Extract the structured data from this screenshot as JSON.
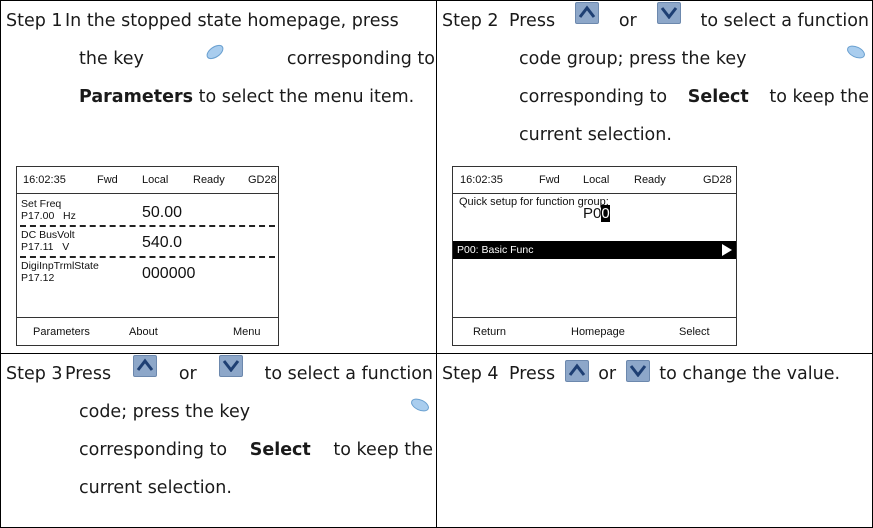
{
  "steps": [
    {
      "number": "Step 1",
      "lines": [
        "In the stopped state homepage, press",
        "the key",
        "corresponding to",
        "Parameters",
        "to select the menu item."
      ]
    },
    {
      "number": "Step 2",
      "lines": [
        "Press",
        "or",
        "to select a function",
        "code group; press the key",
        "corresponding to",
        "Select",
        "to keep the",
        "current selection."
      ]
    },
    {
      "number": "Step 3",
      "lines": [
        "Press",
        "or",
        "to select a function",
        "code; press the key",
        "corresponding to",
        "Select",
        "to keep the",
        "current selection."
      ]
    },
    {
      "number": "Step 4",
      "lines": [
        "Press",
        "or",
        "to change the value."
      ]
    }
  ],
  "screen1": {
    "status": {
      "time": "16:02:35",
      "dir": "Fwd",
      "mode": "Local",
      "state": "Ready",
      "model": "GD28"
    },
    "rows": [
      {
        "label1": "Set Freq",
        "label2": "P17.00   Hz",
        "value": "50.00"
      },
      {
        "label1": "DC BusVolt",
        "label2": "P17.11   V",
        "value": "540.0"
      },
      {
        "label1": "DigiInpTrmlState",
        "label2": "P17.12",
        "value": "000000"
      }
    ],
    "softkeys": {
      "left": "Parameters",
      "middle": "About",
      "right": "Menu"
    }
  },
  "screen2": {
    "status": {
      "time": "16:02:35",
      "dir": "Fwd",
      "mode": "Local",
      "state": "Ready",
      "model": "GD28"
    },
    "prompt": "Quick setup for function group:",
    "group_prefix": "P0",
    "group_cursor": "0",
    "selected_item": "P00: Basic Func",
    "softkeys": {
      "left": "Return",
      "middle": "Homepage",
      "right": "Select"
    }
  },
  "colors": {
    "key_blue": "#8da7c9",
    "oval_key": "#7fb3e0",
    "border": "#000000"
  },
  "icons": [
    "up-arrow-key-icon",
    "down-arrow-key-icon",
    "oval-softkey-icon",
    "selection-triangle-icon"
  ]
}
